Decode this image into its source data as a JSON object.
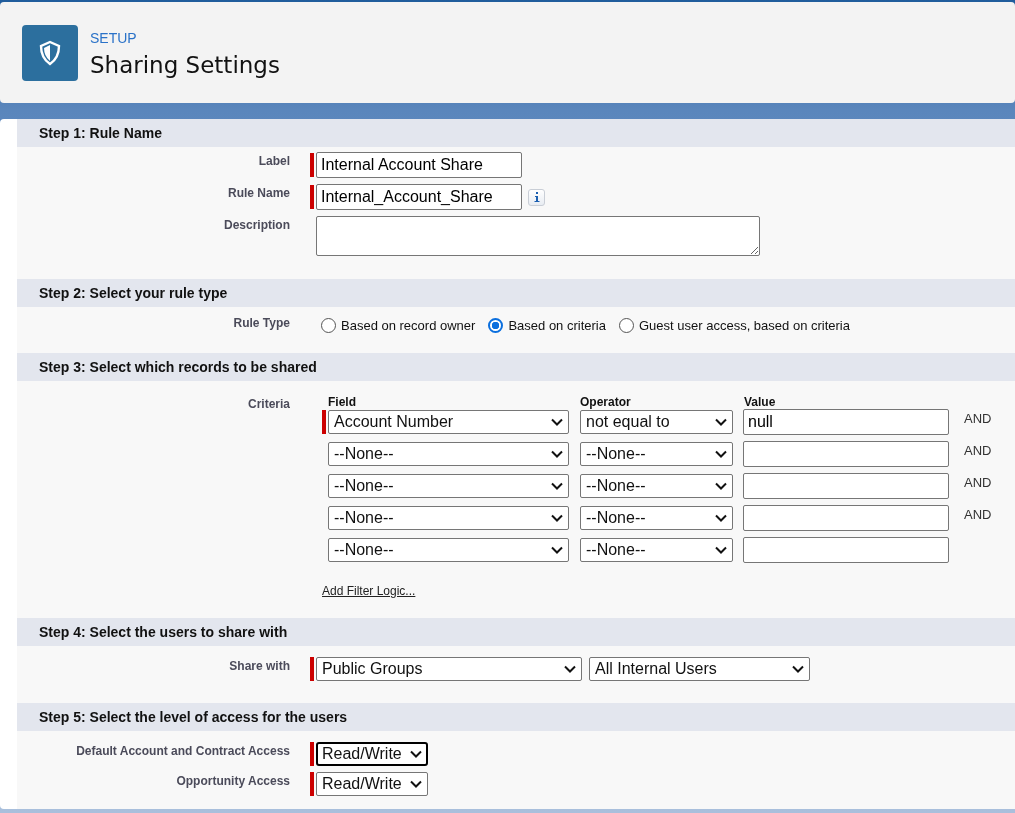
{
  "header": {
    "overline": "SETUP",
    "title": "Sharing Settings"
  },
  "steps": [
    {
      "title": "Step 1: Rule Name",
      "kind": "fields",
      "rows": [
        {
          "label": "Label",
          "kind": "text",
          "value": "Internal Account Share",
          "required": true,
          "info": false
        },
        {
          "label": "Rule Name",
          "kind": "text",
          "value": "Internal_Account_Share",
          "required": true,
          "info": true
        },
        {
          "label": "Description",
          "kind": "textarea",
          "value": "",
          "required": false,
          "info": false
        }
      ]
    },
    {
      "title": "Step 2: Select your rule type",
      "kind": "radios",
      "label": "Rule Type",
      "options": [
        {
          "label": "Based on record owner",
          "selected": false
        },
        {
          "label": "Based on criteria",
          "selected": true
        },
        {
          "label": "Guest user access, based on criteria",
          "selected": false
        }
      ]
    },
    {
      "title": "Step 3: Select which records to be shared",
      "kind": "criteria",
      "label": "Criteria",
      "columns": [
        "Field",
        "Operator",
        "Value"
      ],
      "rows": [
        {
          "field": "Account Number",
          "operator": "not equal to",
          "value": "null",
          "required": true,
          "conjunction": "AND"
        },
        {
          "field": "--None--",
          "operator": "--None--",
          "value": "",
          "required": false,
          "conjunction": "AND"
        },
        {
          "field": "--None--",
          "operator": "--None--",
          "value": "",
          "required": false,
          "conjunction": "AND"
        },
        {
          "field": "--None--",
          "operator": "--None--",
          "value": "",
          "required": false,
          "conjunction": "AND"
        },
        {
          "field": "--None--",
          "operator": "--None--",
          "value": "",
          "required": false,
          "conjunction": ""
        }
      ],
      "link": "Add Filter Logic..."
    },
    {
      "title": "Step 4: Select the users to share with",
      "kind": "share",
      "label": "Share with",
      "required": true,
      "selects": [
        {
          "value": "Public Groups",
          "focused": false
        },
        {
          "value": "All Internal Users",
          "focused": false
        }
      ]
    },
    {
      "title": "Step 5: Select the level of access for the users",
      "kind": "access",
      "rows": [
        {
          "label": "Default Account and Contract Access",
          "value": "Read/Write",
          "required": true,
          "focused": true
        },
        {
          "label": "Opportunity Access",
          "value": "Read/Write",
          "required": true,
          "focused": false
        }
      ]
    }
  ]
}
